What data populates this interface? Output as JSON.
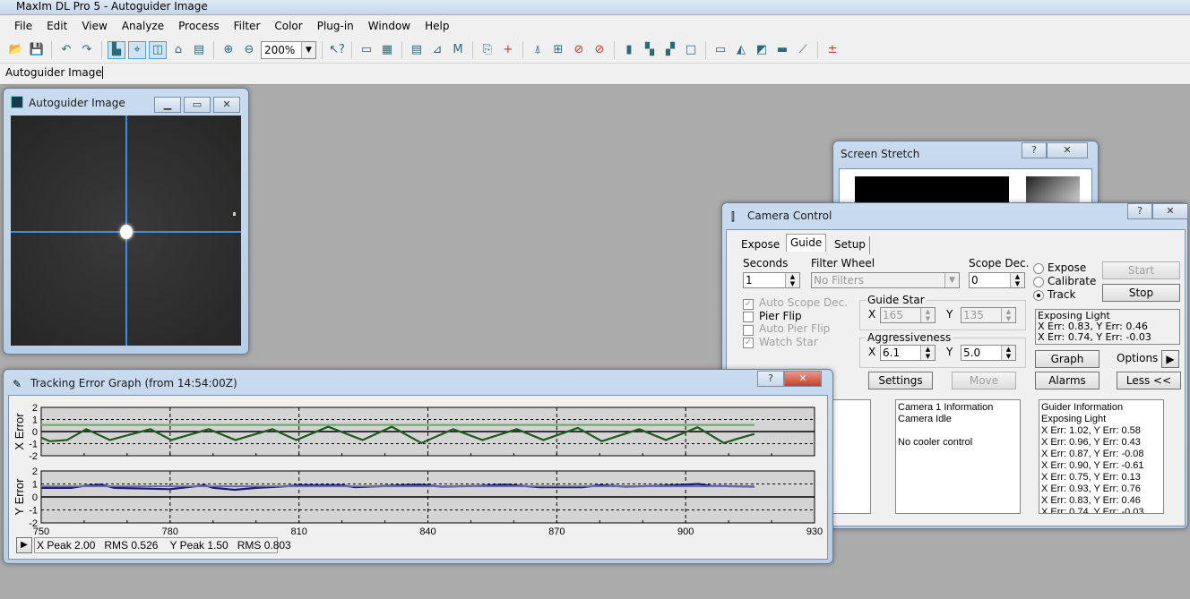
{
  "app": {
    "title": "MaxIm DL Pro 5 - Autoguider Image"
  },
  "menu": [
    "File",
    "Edit",
    "View",
    "Analyze",
    "Process",
    "Filter",
    "Color",
    "Plug-in",
    "Window",
    "Help"
  ],
  "toolbar": {
    "zoom_value": "200%",
    "icons": [
      "open-icon",
      "save-icon",
      "|",
      "undo-icon",
      "redo-icon",
      "|",
      "image-mode-icon",
      "crosshair-icon",
      "flip-icon",
      "lock-icon",
      "properties-icon",
      "|",
      "zoom-in-icon",
      "zoom-out-icon",
      "ZOOM",
      "|",
      "help-pointer-icon",
      "|",
      "ruler-icon",
      "stack-icon",
      "|",
      "document-icon",
      "measure-icon",
      "measure-m-icon",
      "|",
      "copy-icon",
      "add-icon",
      "|",
      "brush-icon",
      "star-box-icon",
      "no-filter-icon",
      "no-flag-icon",
      "|",
      "histogram-icon",
      "teal-squares-icon",
      "teal-square-icon",
      "frame-icon",
      "|",
      "gradient-icon",
      "mountain-icon",
      "curve-box-icon",
      "level-icon",
      "line-icon",
      "|",
      "plus-minus-icon"
    ]
  },
  "doc_tabs": [
    "Autoguider Image"
  ],
  "autoguider_window": {
    "title": "Autoguider Image"
  },
  "screen_stretch": {
    "title": "Screen Stretch"
  },
  "camera_control": {
    "title": "Camera Control",
    "tabs": [
      "Expose",
      "Guide",
      "Setup"
    ],
    "active_tab": "Guide",
    "seconds_label": "Seconds",
    "seconds_value": "1",
    "filter_label": "Filter Wheel",
    "filter_value": "No Filters",
    "scope_dec_label": "Scope Dec.",
    "scope_dec_value": "0",
    "modes": [
      "Expose",
      "Calibrate",
      "Track"
    ],
    "selected_mode": "Track",
    "start_label": "Start",
    "stop_label": "Stop",
    "checkboxes": [
      {
        "label": "Auto Scope Dec.",
        "checked": true,
        "enabled": false
      },
      {
        "label": "Pier Flip",
        "checked": false,
        "enabled": true
      },
      {
        "label": "Auto Pier Flip",
        "checked": false,
        "enabled": false
      },
      {
        "label": "Watch Star",
        "checked": true,
        "enabled": false
      }
    ],
    "guide_star": {
      "label": "Guide Star",
      "x_label": "X",
      "x": "165",
      "y_label": "Y",
      "y": "135"
    },
    "aggressiveness": {
      "label": "Aggressiveness",
      "x_label": "X",
      "x": "6.1",
      "y_label": "Y",
      "y": "5.0"
    },
    "status": [
      "Exposing Light",
      "X Err: 0.83, Y Err: 0.46",
      "X Err: 0.74, Y Err: -0.03"
    ],
    "graph_label": "Graph",
    "options_label": "Options",
    "settings_label": "Settings",
    "move_label": "Move",
    "alarms_label": "Alarms",
    "less_label": "Less <<",
    "camera_info": [
      "Camera 1 Information",
      "Camera Idle",
      "",
      "No cooler control"
    ],
    "guider_info": [
      "Guider Information",
      "Exposing Light",
      "X Err: 1.02, Y Err: 0.58",
      "X Err: 0.96, Y Err: 0.43",
      "X Err: 0.87, Y Err: -0.08",
      "X Err: 0.90, Y Err: -0.61",
      "X Err: 0.75, Y Err: 0.13",
      "X Err: 0.93, Y Err: 0.76",
      "X Err: 0.83, Y Err: 0.46",
      "X Err: 0.74, Y Err: -0.03"
    ]
  },
  "tracking_graph": {
    "title": "Tracking Error Graph (from 14:54:00Z)",
    "stats": "X Peak 2.00   RMS 0.526    Y Peak 1.50   RMS 0.803"
  },
  "chart_data": [
    {
      "type": "line",
      "ylabel": "X Error",
      "ylim": [
        -2,
        2
      ],
      "xlim": [
        750,
        930
      ],
      "yticks": [
        "2",
        "1",
        "0",
        "-1",
        "-2"
      ],
      "colors": {
        "error": "#1e5a1e",
        "reference": "#6aa66a"
      },
      "series": [
        {
          "role": "error",
          "x": [
            750,
            752,
            756,
            760.5,
            766,
            775.4,
            780.3,
            789,
            795.2,
            803.8,
            809.4,
            816.8,
            824.8,
            831.6,
            838.5,
            845.9,
            852.7,
            860.7,
            866.9,
            874.9,
            880.5,
            889.2,
            895.4,
            902.8,
            908.9,
            912,
            916
          ],
          "y": [
            -0.5,
            -0.8,
            -0.7,
            0.2,
            -0.7,
            0.2,
            -0.7,
            0.2,
            -0.7,
            0.2,
            -0.7,
            0.4,
            -0.7,
            0.4,
            -0.95,
            0.2,
            -0.7,
            0.2,
            -0.7,
            0.3,
            -0.8,
            0.2,
            -0.7,
            0.35,
            -0.95,
            -0.6,
            -0.2
          ]
        },
        {
          "role": "reference",
          "x": [
            750,
            916
          ],
          "y": [
            0.55,
            0.55
          ]
        }
      ]
    },
    {
      "type": "line",
      "ylabel": "Y Error",
      "ylim": [
        -2,
        2
      ],
      "xlim": [
        750,
        930
      ],
      "yticks": [
        "2",
        "1",
        "0",
        "-1",
        "-2"
      ],
      "xticks": [
        "750",
        "780",
        "810",
        "840",
        "870",
        "900",
        "930"
      ],
      "colors": {
        "error": "#1a1a6a",
        "reference": "#6a6ab0"
      },
      "series": [
        {
          "role": "error",
          "x": [
            750,
            757,
            760,
            764,
            767,
            780,
            784,
            788,
            790,
            795,
            800,
            806,
            810,
            820,
            823,
            838,
            843,
            852,
            858,
            862,
            866,
            876,
            880,
            886,
            893,
            897,
            903,
            906,
            916
          ],
          "y": [
            0.7,
            0.7,
            0.85,
            0.95,
            0.7,
            0.6,
            0.75,
            0.9,
            0.7,
            0.55,
            0.7,
            0.8,
            0.9,
            0.9,
            0.75,
            0.95,
            0.8,
            0.85,
            0.95,
            0.85,
            0.75,
            0.75,
            0.9,
            0.8,
            0.85,
            0.9,
            1.0,
            0.85,
            0.8
          ]
        },
        {
          "role": "reference",
          "x": [
            750,
            916
          ],
          "y": [
            0.82,
            0.82
          ]
        }
      ]
    }
  ]
}
